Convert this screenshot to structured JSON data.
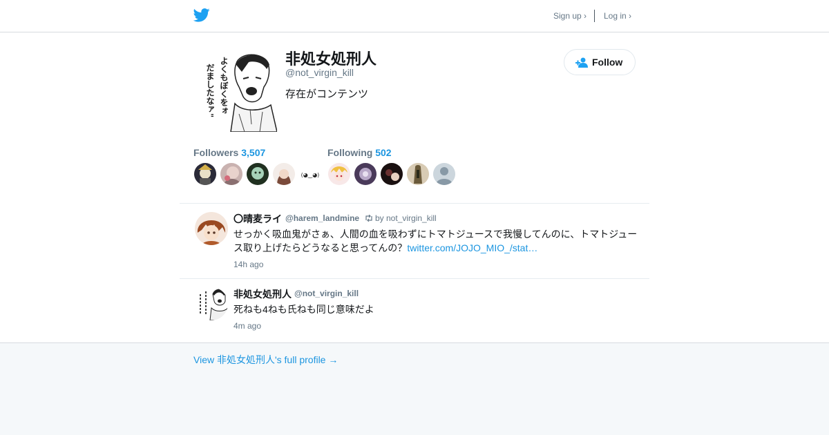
{
  "header": {
    "logo_icon": "twitter-bird-icon",
    "signup_label": "Sign up ›",
    "login_label": "Log in ›"
  },
  "profile": {
    "display_name": "非処女処刑人",
    "handle": "@not_virgin_kill",
    "bio": "存在がコンテンツ",
    "follow_label": "Follow",
    "follow_icon": "add-user-icon",
    "avatar_text": [
      "よくもぼくをォ",
      "だましたなァ\""
    ],
    "followers_label": "Followers",
    "followers_count": "3,507",
    "following_label": "Following",
    "following_count": "502",
    "follower_avatar_kaomoji": "(◕‿◕)"
  },
  "tweets": [
    {
      "name": "〇晴麦ライ",
      "handle": "@harem_landmine",
      "retweet_icon": "retweet-icon",
      "retweet_by": "by not_virgin_kill",
      "text": "せっかく吸血鬼がさぁ、人間の血を吸わずにトマトジュースで我慢してんのに、トマトジュース取り上げたらどうなると思ってんの？",
      "link": "twitter.com/JOJO_MIO_/stat…",
      "time": "14h ago"
    },
    {
      "name": "非処女処刑人",
      "handle": "@not_virgin_kill",
      "text": "死ねも4ねも氏ねも同じ意味だよ",
      "time": "4m ago"
    }
  ],
  "footer": {
    "full_profile_label": "View 非処女処刑人's full profile →"
  },
  "colors": {
    "accent": "#1b95e0",
    "twitter_blue": "#1da1f2",
    "muted": "#657786",
    "background": "#f5f8fa"
  }
}
